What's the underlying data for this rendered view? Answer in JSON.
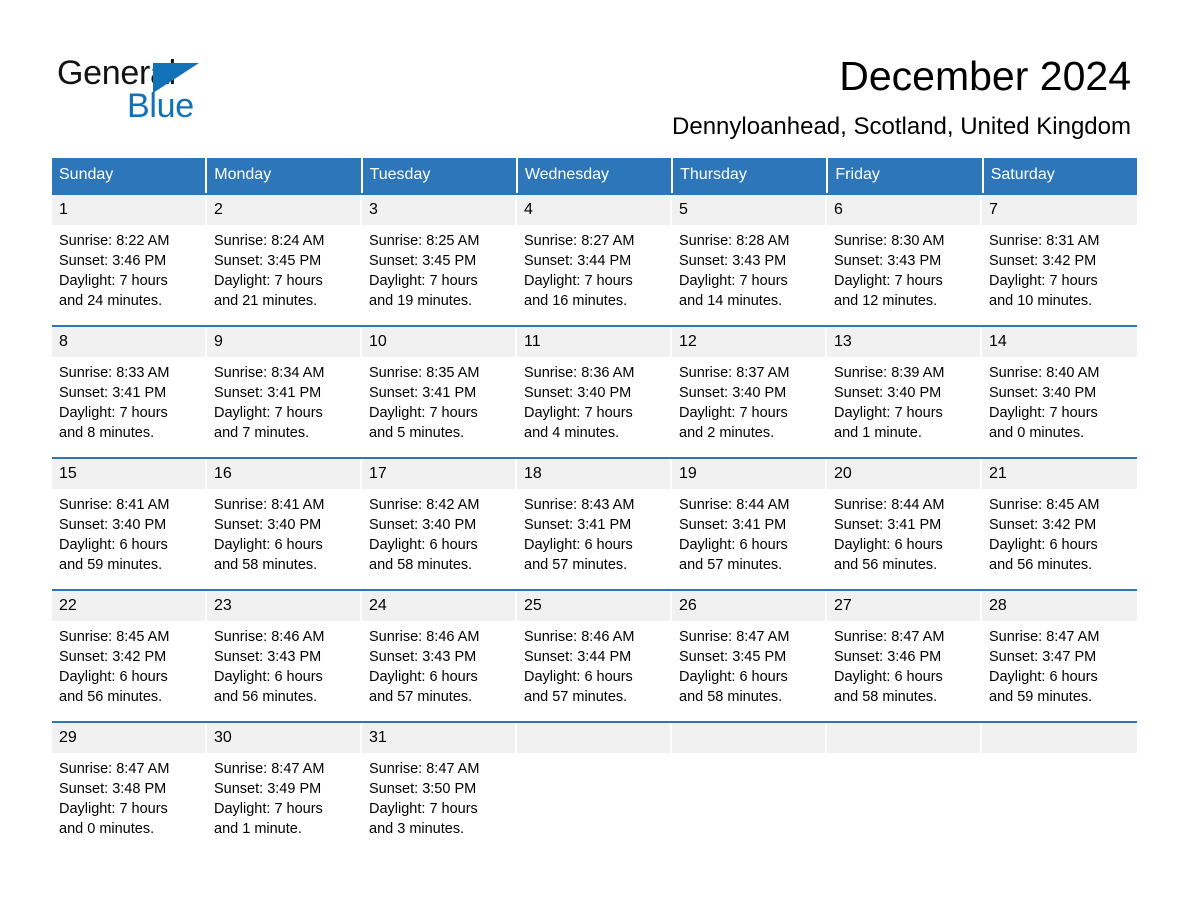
{
  "brand": {
    "name_part1": "General",
    "name_part2": "Blue",
    "triangle_icon": "triangle-icon",
    "accent_color": "#1272b8"
  },
  "header": {
    "title": "December 2024",
    "subtitle": "Dennyloanhead, Scotland, United Kingdom"
  },
  "calendar": {
    "header_color": "#2d76ba",
    "day_band_color": "#f1f1f1",
    "weekdays": [
      "Sunday",
      "Monday",
      "Tuesday",
      "Wednesday",
      "Thursday",
      "Friday",
      "Saturday"
    ],
    "weeks": [
      [
        {
          "day": "1",
          "sunrise": "Sunrise: 8:22 AM",
          "sunset": "Sunset: 3:46 PM",
          "daylight_line1": "Daylight: 7 hours",
          "daylight_line2": "and 24 minutes."
        },
        {
          "day": "2",
          "sunrise": "Sunrise: 8:24 AM",
          "sunset": "Sunset: 3:45 PM",
          "daylight_line1": "Daylight: 7 hours",
          "daylight_line2": "and 21 minutes."
        },
        {
          "day": "3",
          "sunrise": "Sunrise: 8:25 AM",
          "sunset": "Sunset: 3:45 PM",
          "daylight_line1": "Daylight: 7 hours",
          "daylight_line2": "and 19 minutes."
        },
        {
          "day": "4",
          "sunrise": "Sunrise: 8:27 AM",
          "sunset": "Sunset: 3:44 PM",
          "daylight_line1": "Daylight: 7 hours",
          "daylight_line2": "and 16 minutes."
        },
        {
          "day": "5",
          "sunrise": "Sunrise: 8:28 AM",
          "sunset": "Sunset: 3:43 PM",
          "daylight_line1": "Daylight: 7 hours",
          "daylight_line2": "and 14 minutes."
        },
        {
          "day": "6",
          "sunrise": "Sunrise: 8:30 AM",
          "sunset": "Sunset: 3:43 PM",
          "daylight_line1": "Daylight: 7 hours",
          "daylight_line2": "and 12 minutes."
        },
        {
          "day": "7",
          "sunrise": "Sunrise: 8:31 AM",
          "sunset": "Sunset: 3:42 PM",
          "daylight_line1": "Daylight: 7 hours",
          "daylight_line2": "and 10 minutes."
        }
      ],
      [
        {
          "day": "8",
          "sunrise": "Sunrise: 8:33 AM",
          "sunset": "Sunset: 3:41 PM",
          "daylight_line1": "Daylight: 7 hours",
          "daylight_line2": "and 8 minutes."
        },
        {
          "day": "9",
          "sunrise": "Sunrise: 8:34 AM",
          "sunset": "Sunset: 3:41 PM",
          "daylight_line1": "Daylight: 7 hours",
          "daylight_line2": "and 7 minutes."
        },
        {
          "day": "10",
          "sunrise": "Sunrise: 8:35 AM",
          "sunset": "Sunset: 3:41 PM",
          "daylight_line1": "Daylight: 7 hours",
          "daylight_line2": "and 5 minutes."
        },
        {
          "day": "11",
          "sunrise": "Sunrise: 8:36 AM",
          "sunset": "Sunset: 3:40 PM",
          "daylight_line1": "Daylight: 7 hours",
          "daylight_line2": "and 4 minutes."
        },
        {
          "day": "12",
          "sunrise": "Sunrise: 8:37 AM",
          "sunset": "Sunset: 3:40 PM",
          "daylight_line1": "Daylight: 7 hours",
          "daylight_line2": "and 2 minutes."
        },
        {
          "day": "13",
          "sunrise": "Sunrise: 8:39 AM",
          "sunset": "Sunset: 3:40 PM",
          "daylight_line1": "Daylight: 7 hours",
          "daylight_line2": "and 1 minute."
        },
        {
          "day": "14",
          "sunrise": "Sunrise: 8:40 AM",
          "sunset": "Sunset: 3:40 PM",
          "daylight_line1": "Daylight: 7 hours",
          "daylight_line2": "and 0 minutes."
        }
      ],
      [
        {
          "day": "15",
          "sunrise": "Sunrise: 8:41 AM",
          "sunset": "Sunset: 3:40 PM",
          "daylight_line1": "Daylight: 6 hours",
          "daylight_line2": "and 59 minutes."
        },
        {
          "day": "16",
          "sunrise": "Sunrise: 8:41 AM",
          "sunset": "Sunset: 3:40 PM",
          "daylight_line1": "Daylight: 6 hours",
          "daylight_line2": "and 58 minutes."
        },
        {
          "day": "17",
          "sunrise": "Sunrise: 8:42 AM",
          "sunset": "Sunset: 3:40 PM",
          "daylight_line1": "Daylight: 6 hours",
          "daylight_line2": "and 58 minutes."
        },
        {
          "day": "18",
          "sunrise": "Sunrise: 8:43 AM",
          "sunset": "Sunset: 3:41 PM",
          "daylight_line1": "Daylight: 6 hours",
          "daylight_line2": "and 57 minutes."
        },
        {
          "day": "19",
          "sunrise": "Sunrise: 8:44 AM",
          "sunset": "Sunset: 3:41 PM",
          "daylight_line1": "Daylight: 6 hours",
          "daylight_line2": "and 57 minutes."
        },
        {
          "day": "20",
          "sunrise": "Sunrise: 8:44 AM",
          "sunset": "Sunset: 3:41 PM",
          "daylight_line1": "Daylight: 6 hours",
          "daylight_line2": "and 56 minutes."
        },
        {
          "day": "21",
          "sunrise": "Sunrise: 8:45 AM",
          "sunset": "Sunset: 3:42 PM",
          "daylight_line1": "Daylight: 6 hours",
          "daylight_line2": "and 56 minutes."
        }
      ],
      [
        {
          "day": "22",
          "sunrise": "Sunrise: 8:45 AM",
          "sunset": "Sunset: 3:42 PM",
          "daylight_line1": "Daylight: 6 hours",
          "daylight_line2": "and 56 minutes."
        },
        {
          "day": "23",
          "sunrise": "Sunrise: 8:46 AM",
          "sunset": "Sunset: 3:43 PM",
          "daylight_line1": "Daylight: 6 hours",
          "daylight_line2": "and 56 minutes."
        },
        {
          "day": "24",
          "sunrise": "Sunrise: 8:46 AM",
          "sunset": "Sunset: 3:43 PM",
          "daylight_line1": "Daylight: 6 hours",
          "daylight_line2": "and 57 minutes."
        },
        {
          "day": "25",
          "sunrise": "Sunrise: 8:46 AM",
          "sunset": "Sunset: 3:44 PM",
          "daylight_line1": "Daylight: 6 hours",
          "daylight_line2": "and 57 minutes."
        },
        {
          "day": "26",
          "sunrise": "Sunrise: 8:47 AM",
          "sunset": "Sunset: 3:45 PM",
          "daylight_line1": "Daylight: 6 hours",
          "daylight_line2": "and 58 minutes."
        },
        {
          "day": "27",
          "sunrise": "Sunrise: 8:47 AM",
          "sunset": "Sunset: 3:46 PM",
          "daylight_line1": "Daylight: 6 hours",
          "daylight_line2": "and 58 minutes."
        },
        {
          "day": "28",
          "sunrise": "Sunrise: 8:47 AM",
          "sunset": "Sunset: 3:47 PM",
          "daylight_line1": "Daylight: 6 hours",
          "daylight_line2": "and 59 minutes."
        }
      ],
      [
        {
          "day": "29",
          "sunrise": "Sunrise: 8:47 AM",
          "sunset": "Sunset: 3:48 PM",
          "daylight_line1": "Daylight: 7 hours",
          "daylight_line2": "and 0 minutes."
        },
        {
          "day": "30",
          "sunrise": "Sunrise: 8:47 AM",
          "sunset": "Sunset: 3:49 PM",
          "daylight_line1": "Daylight: 7 hours",
          "daylight_line2": "and 1 minute."
        },
        {
          "day": "31",
          "sunrise": "Sunrise: 8:47 AM",
          "sunset": "Sunset: 3:50 PM",
          "daylight_line1": "Daylight: 7 hours",
          "daylight_line2": "and 3 minutes."
        },
        {
          "day": "",
          "sunrise": "",
          "sunset": "",
          "daylight_line1": "",
          "daylight_line2": ""
        },
        {
          "day": "",
          "sunrise": "",
          "sunset": "",
          "daylight_line1": "",
          "daylight_line2": ""
        },
        {
          "day": "",
          "sunrise": "",
          "sunset": "",
          "daylight_line1": "",
          "daylight_line2": ""
        },
        {
          "day": "",
          "sunrise": "",
          "sunset": "",
          "daylight_line1": "",
          "daylight_line2": ""
        }
      ]
    ]
  }
}
